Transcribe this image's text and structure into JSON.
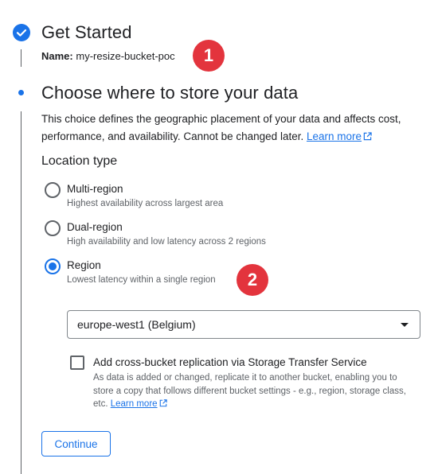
{
  "steps": [
    {
      "title": "Get Started",
      "status": "completed",
      "summary_label": "Name:",
      "summary_value": " my-resize-bucket-poc"
    },
    {
      "title": "Choose where to store your data",
      "status": "active",
      "description": "This choice defines the geographic placement of your data and affects cost, performance, and availability. Cannot be changed later.",
      "learn_more": "Learn more"
    }
  ],
  "location_type": {
    "label": "Location type",
    "options": [
      {
        "label": "Multi-region",
        "sublabel": "Highest availability across largest area",
        "selected": false
      },
      {
        "label": "Dual-region",
        "sublabel": "High availability and low latency across 2 regions",
        "selected": false
      },
      {
        "label": "Region",
        "sublabel": "Lowest latency within a single region",
        "selected": true
      }
    ],
    "region_select": {
      "value": "europe-west1 (Belgium)"
    }
  },
  "replication": {
    "label": "Add cross-bucket replication via Storage Transfer Service",
    "description": "As data is added or changed, replicate it to another bucket, enabling you to store a copy that follows different bucket settings - e.g., region, storage class, etc.",
    "learn_more": "Learn more",
    "checked": false
  },
  "continue_label": "Continue",
  "annotations": [
    "1",
    "2"
  ],
  "colors": {
    "accent": "#1a73e8",
    "badge": "#e3343d",
    "text": "#202124",
    "secondary_text": "#5f6368"
  }
}
